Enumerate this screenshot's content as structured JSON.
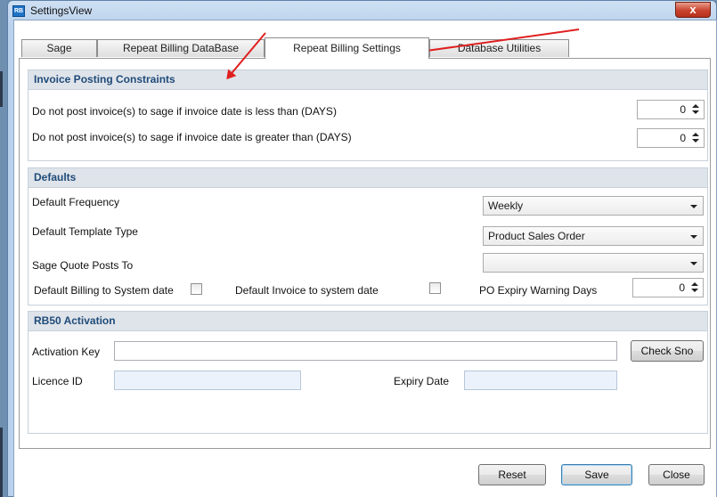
{
  "window": {
    "title": "SettingsView",
    "close_glyph": "x"
  },
  "tabs": [
    {
      "label": "Sage"
    },
    {
      "label": "Repeat Billing DataBase"
    },
    {
      "label": "Repeat Billing Settings"
    },
    {
      "label": "Database Utilities"
    }
  ],
  "active_tab": "Repeat Billing Settings",
  "invoice_posting": {
    "header": "Invoice Posting Constraints",
    "less_than_label": "Do not post invoice(s) to sage if invoice date is less than (DAYS)",
    "less_than_value": "0",
    "greater_than_label": "Do not post invoice(s) to sage if invoice date is greater than (DAYS)",
    "greater_than_value": "0"
  },
  "defaults": {
    "header": "Defaults",
    "frequency_label": "Default Frequency",
    "frequency_value": "Weekly",
    "template_label": "Default Template Type",
    "template_value": "Product Sales Order",
    "quote_label": "Sage Quote Posts To",
    "quote_value": "",
    "billing_date_label": "Default Billing to System date",
    "billing_date_checked": false,
    "invoice_date_label": "Default Invoice to system date",
    "invoice_date_checked": false,
    "po_expiry_label": "PO Expiry Warning Days",
    "po_expiry_value": "0"
  },
  "activation": {
    "header": "RB50 Activation",
    "key_label": "Activation Key",
    "key_value": "",
    "check_button": "Check Sno",
    "licence_label": "Licence ID",
    "licence_value": "",
    "expiry_label": "Expiry Date",
    "expiry_value": ""
  },
  "footer": {
    "reset": "Reset",
    "save": "Save",
    "close": "Close"
  },
  "colors": {
    "header_text": "#1f4b79",
    "annotation_arrow": "#e02020"
  }
}
